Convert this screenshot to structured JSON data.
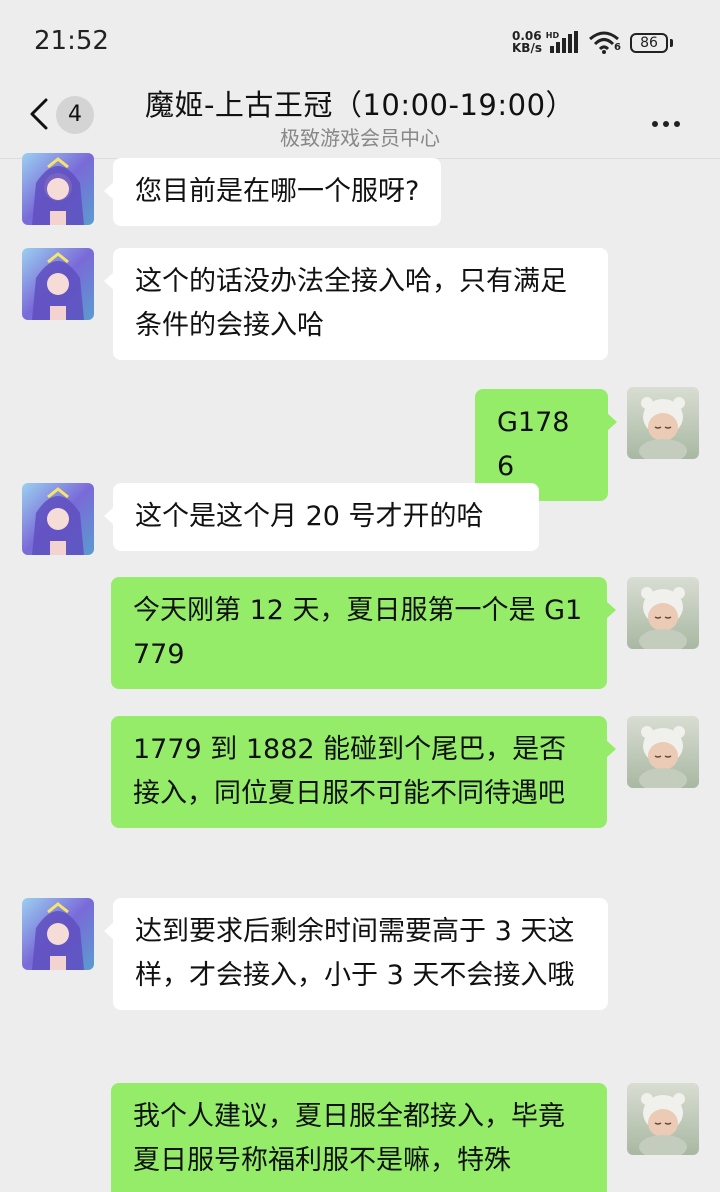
{
  "status_bar": {
    "time": "21:52",
    "net_speed_value": "0.06",
    "net_speed_unit": "KB/s",
    "hd_label": "HD",
    "wifi_label": "6",
    "battery": "86"
  },
  "header": {
    "back_badge": "4",
    "title": "魔姬-上古王冠（10:00-19:00）",
    "subtitle": "极致游戏会员中心"
  },
  "messages": [
    {
      "side": "in",
      "text": "您目前是在哪一个服呀?"
    },
    {
      "side": "in",
      "text": "这个的话没办法全接入哈，只有满足条件的会接入哈"
    },
    {
      "side": "out",
      "text": "G1786"
    },
    {
      "side": "in",
      "text": "这个是这个月 20 号才开的哈"
    },
    {
      "side": "out",
      "text": "今天刚第 12 天，夏日服第一个是 G1779"
    },
    {
      "side": "out",
      "text": "1779 到 1882 能碰到个尾巴，是否接入，同位夏日服不可能不同待遇吧"
    },
    {
      "side": "in",
      "text": "达到要求后剩余时间需要高于 3 天这样，才会接入，小于 3 天不会接入哦"
    },
    {
      "side": "out",
      "text": "我个人建议，夏日服全都接入，毕竟夏日服号称福利服不是嘛，特殊"
    }
  ],
  "colors": {
    "background": "#ededed",
    "incoming_bubble": "#ffffff",
    "outgoing_bubble": "#95ec69"
  },
  "icons": {
    "back": "chevron-left-icon",
    "more": "more-dots-icon",
    "signal": "signal-bars-icon",
    "wifi": "wifi-icon",
    "battery": "battery-icon"
  }
}
